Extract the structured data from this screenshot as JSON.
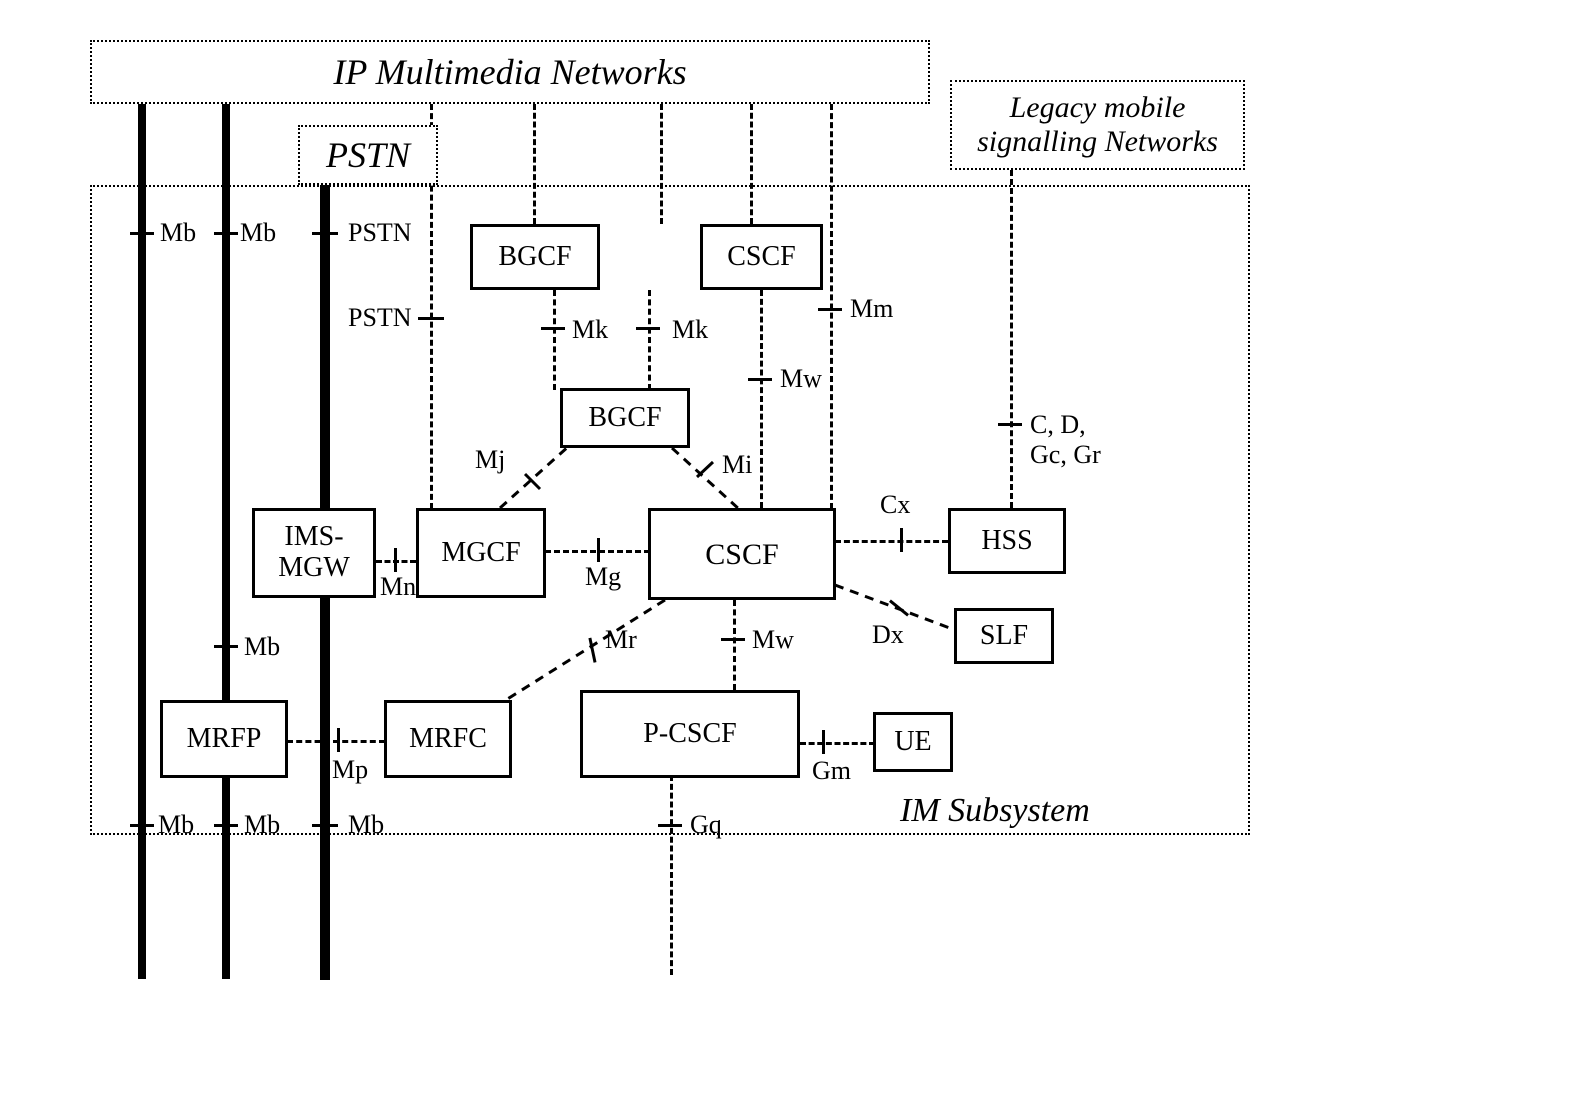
{
  "regions": {
    "ip_multimedia": "IP Multimedia Networks",
    "pstn": "PSTN",
    "legacy": "Legacy mobile\nsignalling Networks",
    "im_subsystem": "IM Subsystem"
  },
  "nodes": {
    "bgcf_top": "BGCF",
    "cscf_top": "CSCF",
    "bgcf_mid": "BGCF",
    "ims_mgw": "IMS-\nMGW",
    "mgcf": "MGCF",
    "cscf_main": "CSCF",
    "hss": "HSS",
    "slf": "SLF",
    "mrfp": "MRFP",
    "mrfc": "MRFC",
    "p_cscf": "P-CSCF",
    "ue": "UE"
  },
  "ifaces": {
    "mb1": "Mb",
    "mb2": "Mb",
    "pstn1": "PSTN",
    "pstn2": "PSTN",
    "mk1": "Mk",
    "mk2": "Mk",
    "mm": "Mm",
    "mw1": "Mw",
    "mj": "Mj",
    "mi": "Mi",
    "cd": "C, D,\nGc, Gr",
    "cx": "Cx",
    "mn": "Mn",
    "mg": "Mg",
    "dx": "Dx",
    "mr": "Mr",
    "mw2": "Mw",
    "mb3": "Mb",
    "mp": "Mp",
    "gm": "Gm",
    "mb4": "Mb",
    "mb5": "Mb",
    "mb6": "Mb",
    "gq": "Gq"
  }
}
